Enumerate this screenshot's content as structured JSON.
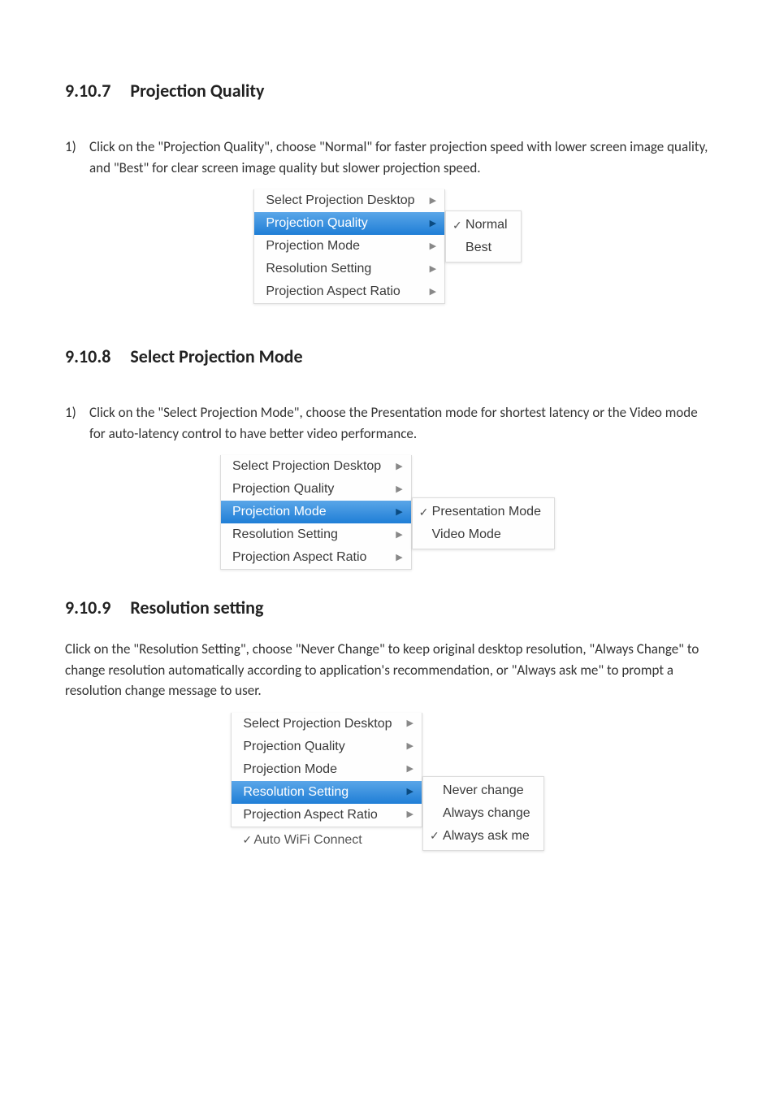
{
  "section1": {
    "number": "9.10.7",
    "title": "Projection Quality",
    "item_number": "1)",
    "item_text": "Click on the \"Projection Quality\", choose \"Normal\" for faster projection speed with lower screen image quality, and \"Best\" for clear screen image quality but slower projection speed.",
    "menu": {
      "items": [
        "Select Projection Desktop",
        "Projection Quality",
        "Projection Mode",
        "Resolution Setting",
        "Projection Aspect Ratio"
      ],
      "selected_index": 1,
      "submenu": [
        "Normal",
        "Best"
      ],
      "checked_index": 0
    }
  },
  "section2": {
    "number": "9.10.8",
    "title": "Select Projection Mode",
    "item_number": "1)",
    "item_text": "Click on the \"Select Projection Mode\", choose the Presentation mode for shortest latency or the Video mode for auto-latency control to have better video performance.",
    "menu": {
      "items": [
        "Select Projection Desktop",
        "Projection Quality",
        "Projection Mode",
        "Resolution Setting",
        "Projection Aspect Ratio"
      ],
      "selected_index": 2,
      "submenu": [
        "Presentation Mode",
        "Video Mode"
      ],
      "checked_index": 0
    }
  },
  "section3": {
    "number": "9.10.9",
    "title": "Resolution setting",
    "body_text": "Click on the \"Resolution Setting\", choose \"Never Change\" to keep original desktop resolution, \"Always Change\" to change resolution automatically according to application's recommendation, or \"Always ask me\" to prompt a resolution change message to user.",
    "menu": {
      "items": [
        "Select Projection Desktop",
        "Projection Quality",
        "Projection Mode",
        "Resolution Setting",
        "Projection Aspect Ratio"
      ],
      "selected_index": 3,
      "submenu": [
        "Never change",
        "Always change",
        "Always ask me"
      ],
      "checked_index": 2,
      "extra_item": "Auto WiFi Connect"
    }
  },
  "arrow_glyph": "▶",
  "check_glyph": "✓"
}
